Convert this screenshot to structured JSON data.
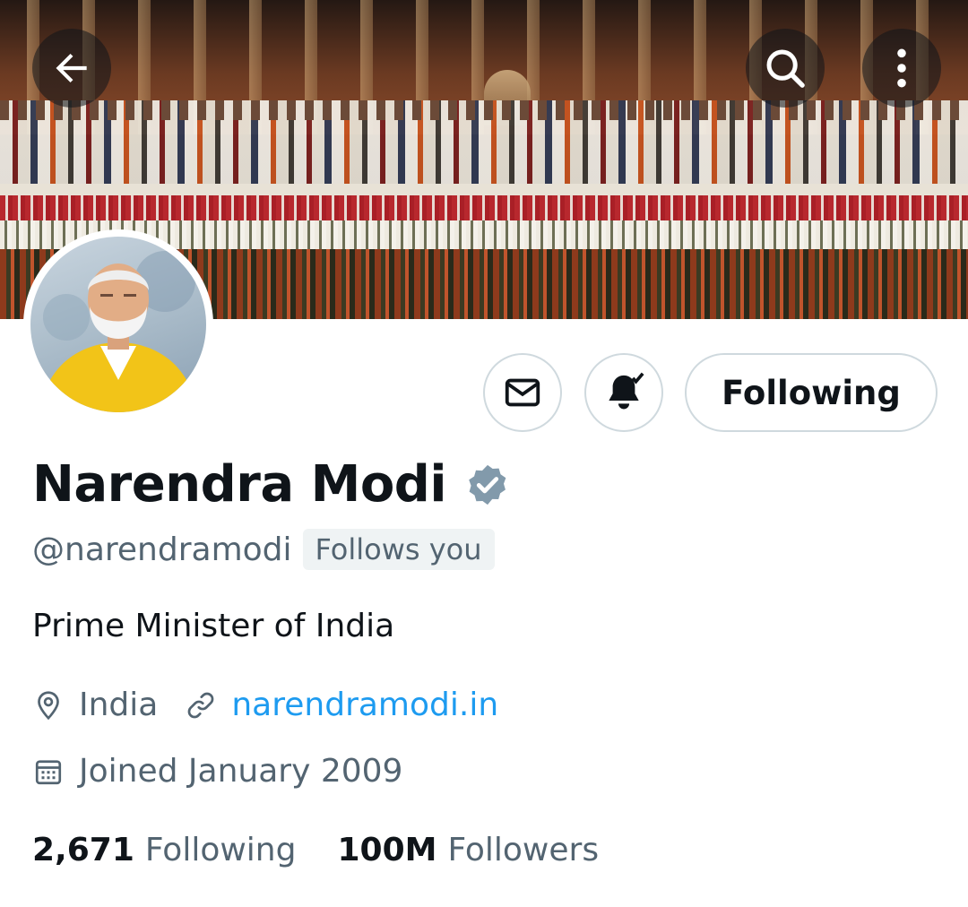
{
  "banner": {
    "image": "group-photo-banner",
    "back_icon": "arrow-left-icon",
    "search_icon": "search-icon",
    "more_icon": "more-vertical-icon"
  },
  "avatar": {
    "image": "profile-photo"
  },
  "actions": {
    "message_icon": "mail-icon",
    "notify_icon": "bell-check-icon",
    "follow_label": "Following"
  },
  "profile": {
    "name": "Narendra Modi",
    "verified_icon": "verified-badge-icon",
    "verified_color": "#829aab",
    "handle": "@narendramodi",
    "follows_you": "Follows you",
    "bio": "Prime Minister of India",
    "location": "India",
    "website": "narendramodi.in",
    "joined": "Joined January 2009",
    "link_color": "#1d9bf0"
  },
  "stats": {
    "following_count": "2,671",
    "following_label": "Following",
    "followers_count": "100M",
    "followers_label": "Followers"
  }
}
